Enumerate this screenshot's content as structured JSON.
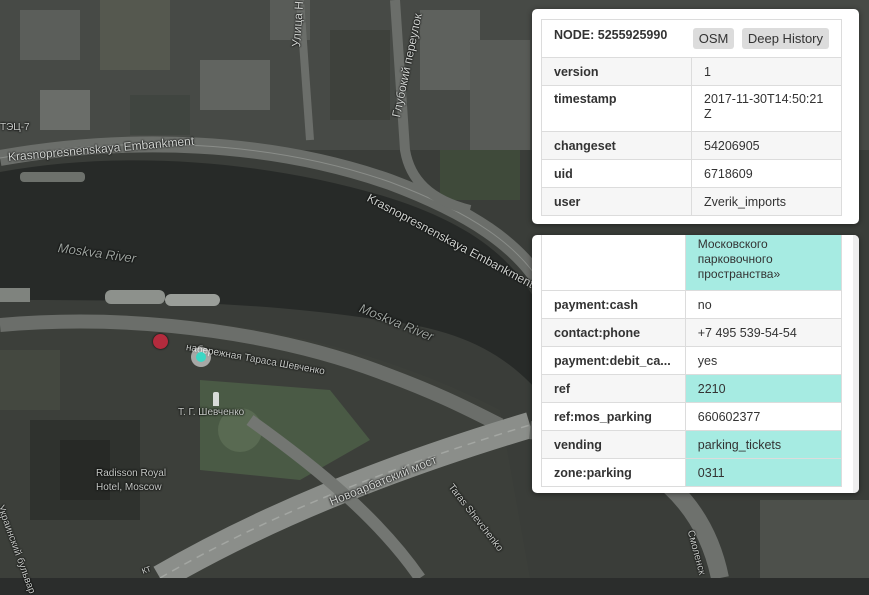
{
  "map": {
    "labels": {
      "embankment_top": "Krasnopresnenskaya Embankment",
      "embankment_diag": "Krasnopresnenskaya Embankment",
      "river_left": "Moskva River",
      "river_right": "Moskva River",
      "street_ulitsa": "Улица Н",
      "street_glubokiy": "Глубокий переулок",
      "tets": "ТЭЦ-7",
      "naberezhnaya": "набережная Тараса Шевченко",
      "monument": "Т. Г. Шевченко",
      "hotel_line1": "Radisson Royal",
      "hotel_line2": "Hotel, Moscow",
      "bridge": "Новоарбатский мост",
      "taras_road": "Taras Shevchenko",
      "ukr_blvd": "Украинский бульвар",
      "smolensk": "Смоленск",
      "kt": "кт"
    }
  },
  "node_panel": {
    "title": "NODE: 5255925990",
    "osm_button": "OSM",
    "history_button": "Deep History",
    "rows": [
      {
        "key": "version",
        "value": "1"
      },
      {
        "key": "timestamp",
        "value": "2017-11-30T14:50:21Z"
      },
      {
        "key": "changeset",
        "value": "54206905"
      },
      {
        "key": "uid",
        "value": "6718609"
      },
      {
        "key": "user",
        "value": "Zverik_imports"
      }
    ]
  },
  "tags_panel": {
    "partial_value": "Московского парковочного пространства»",
    "rows": [
      {
        "key": "payment:cash",
        "value": "no"
      },
      {
        "key": "contact:phone",
        "value": "+7 495 539-54-54"
      },
      {
        "key": "payment:debit_ca...",
        "value": "yes"
      },
      {
        "key": "ref",
        "value": "2210"
      },
      {
        "key": "ref:mos_parking",
        "value": "660602377"
      },
      {
        "key": "vending",
        "value": "parking_tickets"
      },
      {
        "key": "zone:parking",
        "value": "0311"
      }
    ]
  },
  "colors": {
    "highlight": "#a6ebe2",
    "pin_red": "#b32b3d",
    "pin_teal": "#3ad7c4"
  }
}
